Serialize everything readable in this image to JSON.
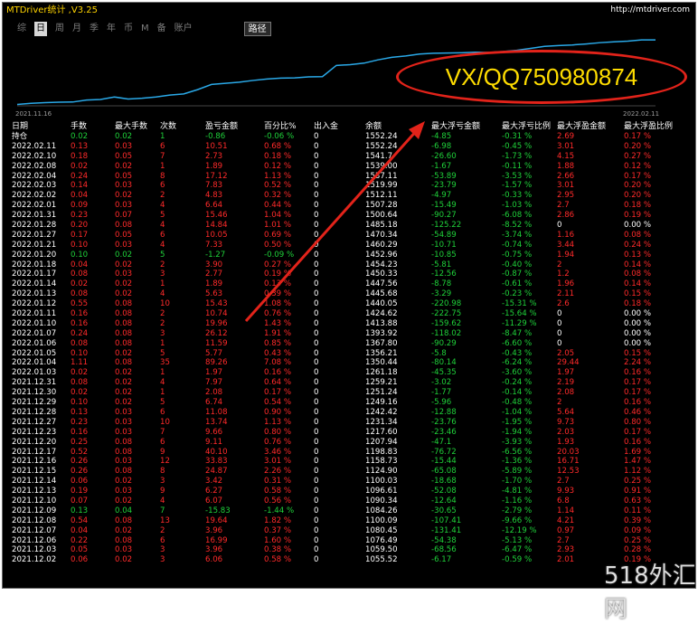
{
  "window": {
    "title": "MTDriver统计 ,V3.25",
    "url": "http://mtdriver.com"
  },
  "tabs": [
    {
      "label": "综",
      "active": false
    },
    {
      "label": "日",
      "active": true
    },
    {
      "label": "周",
      "active": false
    },
    {
      "label": "月",
      "active": false
    },
    {
      "label": "季",
      "active": false
    },
    {
      "label": "年",
      "active": false
    },
    {
      "label": "币",
      "active": false
    },
    {
      "label": "M",
      "active": false
    },
    {
      "label": "备",
      "active": false
    },
    {
      "label": "账户",
      "active": false
    }
  ],
  "path_button": "路径",
  "chart_data": {
    "type": "line",
    "x_start_label": "2021.11.16",
    "x_end_label": "2022.02.11",
    "y": [
      1041,
      1050,
      1055,
      1059,
      1060,
      1076,
      1080,
      1100,
      1084,
      1090,
      1100,
      1115,
      1124,
      1158,
      1199,
      1208,
      1217,
      1231,
      1242,
      1249,
      1251,
      1259,
      1261,
      1350,
      1356,
      1368,
      1394,
      1414,
      1425,
      1440,
      1446,
      1448,
      1450,
      1454,
      1453,
      1460,
      1470,
      1485,
      1501,
      1507,
      1512,
      1520,
      1530,
      1537,
      1542,
      1552,
      1552
    ],
    "ylim": [
      1030,
      1560
    ],
    "color": "#2aa9e8"
  },
  "watermark": "VX/QQ750980874",
  "brand": "518外汇网",
  "colors": {
    "red": "#ff2a2a",
    "green": "#1fd13a",
    "line": "#2aa9e8",
    "title": "#ffd400"
  },
  "table": {
    "headers": [
      "日期",
      "手数",
      "最大手数",
      "次数",
      "盈亏金额",
      "百分比%",
      "出入金",
      "余额",
      "最大浮亏金额",
      "最大浮亏比例",
      "最大浮盈金额",
      "最大浮盈比例"
    ],
    "rows": [
      [
        "持仓",
        "0.02",
        "0.02",
        "1",
        "-0.86",
        "-0.06 %",
        "0",
        "1552.24",
        "-4.85",
        "-0.31 %",
        "2.69",
        "0.17 %"
      ],
      [
        "2022.02.11",
        "0.13",
        "0.03",
        "6",
        "10.51",
        "0.68 %",
        "0",
        "1552.24",
        "-6.98",
        "-0.45 %",
        "3.01",
        "0.20 %"
      ],
      [
        "2022.02.10",
        "0.18",
        "0.05",
        "7",
        "2.73",
        "0.18 %",
        "0",
        "1541.7",
        "-26.60",
        "-1.73 %",
        "4.15",
        "0.27 %"
      ],
      [
        "2022.02.08",
        "0.02",
        "0.02",
        "1",
        "1.89",
        "0.12 %",
        "0",
        "1539.00",
        "-1.67",
        "-0.11 %",
        "1.88",
        "0.12 %"
      ],
      [
        "2022.02.04",
        "0.24",
        "0.05",
        "8",
        "17.12",
        "1.13 %",
        "0",
        "1537.11",
        "-53.89",
        "-3.53 %",
        "2.66",
        "0.17 %"
      ],
      [
        "2022.02.03",
        "0.14",
        "0.03",
        "6",
        "7.83",
        "0.52 %",
        "0",
        "1519.99",
        "-23.79",
        "-1.57 %",
        "3.01",
        "0.20 %"
      ],
      [
        "2022.02.02",
        "0.04",
        "0.02",
        "2",
        "4.83",
        "0.32 %",
        "0",
        "1512.11",
        "-4.97",
        "-0.33 %",
        "2.95",
        "0.20 %"
      ],
      [
        "2022.02.01",
        "0.09",
        "0.03",
        "4",
        "6.64",
        "0.44 %",
        "0",
        "1507.28",
        "-15.49",
        "-1.03 %",
        "2.7",
        "0.18 %"
      ],
      [
        "2022.01.31",
        "0.23",
        "0.07",
        "5",
        "15.46",
        "1.04 %",
        "0",
        "1500.64",
        "-90.27",
        "-6.08 %",
        "2.86",
        "0.19 %"
      ],
      [
        "2022.01.28",
        "0.20",
        "0.08",
        "4",
        "14.84",
        "1.01 %",
        "0",
        "1485.18",
        "-125.22",
        "-8.52 %",
        "0",
        "0.00 %"
      ],
      [
        "2022.01.27",
        "0.17",
        "0.05",
        "6",
        "10.05",
        "0.69 %",
        "0",
        "1470.34",
        "-54.89",
        "-3.74 %",
        "1.16",
        "0.08 %"
      ],
      [
        "2022.01.21",
        "0.10",
        "0.03",
        "4",
        "7.33",
        "0.50 %",
        "0",
        "1460.29",
        "-10.71",
        "-0.74 %",
        "3.44",
        "0.24 %"
      ],
      [
        "2022.01.20",
        "0.10",
        "0.02",
        "5",
        "-1.27",
        "-0.09 %",
        "0",
        "1452.96",
        "-10.85",
        "-0.75 %",
        "1.94",
        "0.13 %"
      ],
      [
        "2022.01.18",
        "0.04",
        "0.02",
        "2",
        "3.90",
        "0.27 %",
        "0",
        "1454.23",
        "-5.81",
        "-0.40 %",
        "2",
        "0.14 %"
      ],
      [
        "2022.01.17",
        "0.08",
        "0.03",
        "3",
        "2.77",
        "0.19 %",
        "0",
        "1450.33",
        "-12.56",
        "-0.87 %",
        "1.2",
        "0.08 %"
      ],
      [
        "2022.01.14",
        "0.02",
        "0.02",
        "1",
        "1.89",
        "0.13 %",
        "0",
        "1447.56",
        "-8.78",
        "-0.61 %",
        "1.96",
        "0.14 %"
      ],
      [
        "2022.01.13",
        "0.08",
        "0.02",
        "4",
        "5.63",
        "0.39 %",
        "0",
        "1445.68",
        "-3.29",
        "-0.23 %",
        "2.11",
        "0.15 %"
      ],
      [
        "2022.01.12",
        "0.55",
        "0.08",
        "10",
        "15.43",
        "1.08 %",
        "0",
        "1440.05",
        "-220.98",
        "-15.31 %",
        "2.6",
        "0.18 %"
      ],
      [
        "2022.01.11",
        "0.16",
        "0.08",
        "2",
        "10.74",
        "0.76 %",
        "0",
        "1424.62",
        "-222.75",
        "-15.64 %",
        "0",
        "0.00 %"
      ],
      [
        "2022.01.10",
        "0.16",
        "0.08",
        "2",
        "19.96",
        "1.43 %",
        "0",
        "1413.88",
        "-159.62",
        "-11.29 %",
        "0",
        "0.00 %"
      ],
      [
        "2022.01.07",
        "0.24",
        "0.08",
        "3",
        "26.12",
        "1.91 %",
        "0",
        "1393.92",
        "-118.02",
        "-8.47 %",
        "0",
        "0.00 %"
      ],
      [
        "2022.01.06",
        "0.08",
        "0.08",
        "1",
        "11.59",
        "0.85 %",
        "0",
        "1367.80",
        "-90.29",
        "-6.60 %",
        "0",
        "0.00 %"
      ],
      [
        "2022.01.05",
        "0.10",
        "0.02",
        "5",
        "5.77",
        "0.43 %",
        "0",
        "1356.21",
        "-5.8",
        "-0.43 %",
        "2.05",
        "0.15 %"
      ],
      [
        "2022.01.04",
        "1.11",
        "0.08",
        "35",
        "89.26",
        "7.08 %",
        "0",
        "1350.44",
        "-80.14",
        "-6.24 %",
        "29.44",
        "2.24 %"
      ],
      [
        "2022.01.03",
        "0.02",
        "0.02",
        "1",
        "1.97",
        "0.16 %",
        "0",
        "1261.18",
        "-45.35",
        "-3.60 %",
        "1.97",
        "0.16 %"
      ],
      [
        "2021.12.31",
        "0.08",
        "0.02",
        "4",
        "7.97",
        "0.64 %",
        "0",
        "1259.21",
        "-3.02",
        "-0.24 %",
        "2.19",
        "0.17 %"
      ],
      [
        "2021.12.30",
        "0.02",
        "0.02",
        "1",
        "2.08",
        "0.17 %",
        "0",
        "1251.24",
        "-1.77",
        "-0.14 %",
        "2.08",
        "0.17 %"
      ],
      [
        "2021.12.29",
        "0.10",
        "0.02",
        "5",
        "6.74",
        "0.54 %",
        "0",
        "1249.16",
        "-5.96",
        "-0.48 %",
        "2",
        "0.16 %"
      ],
      [
        "2021.12.28",
        "0.13",
        "0.03",
        "6",
        "11.08",
        "0.90 %",
        "0",
        "1242.42",
        "-12.88",
        "-1.04 %",
        "5.64",
        "0.46 %"
      ],
      [
        "2021.12.27",
        "0.23",
        "0.03",
        "10",
        "13.74",
        "1.13 %",
        "0",
        "1231.34",
        "-23.76",
        "-1.95 %",
        "9.73",
        "0.80 %"
      ],
      [
        "2021.12.23",
        "0.16",
        "0.03",
        "7",
        "9.66",
        "0.80 %",
        "0",
        "1217.60",
        "-23.46",
        "-1.94 %",
        "2.03",
        "0.17 %"
      ],
      [
        "2021.12.20",
        "0.25",
        "0.08",
        "6",
        "9.11",
        "0.76 %",
        "0",
        "1207.94",
        "-47.1",
        "-3.93 %",
        "1.93",
        "0.16 %"
      ],
      [
        "2021.12.17",
        "0.52",
        "0.08",
        "9",
        "40.10",
        "3.46 %",
        "0",
        "1198.83",
        "-76.72",
        "-6.56 %",
        "20.03",
        "1.69 %"
      ],
      [
        "2021.12.16",
        "0.26",
        "0.03",
        "12",
        "33.83",
        "3.01 %",
        "0",
        "1158.73",
        "-15.44",
        "-1.36 %",
        "16.71",
        "1.47 %"
      ],
      [
        "2021.12.15",
        "0.26",
        "0.08",
        "8",
        "24.87",
        "2.26 %",
        "0",
        "1124.90",
        "-65.08",
        "-5.89 %",
        "12.53",
        "1.12 %"
      ],
      [
        "2021.12.14",
        "0.06",
        "0.02",
        "3",
        "3.42",
        "0.31 %",
        "0",
        "1100.03",
        "-18.68",
        "-1.70 %",
        "2.7",
        "0.25 %"
      ],
      [
        "2021.12.13",
        "0.19",
        "0.03",
        "9",
        "6.27",
        "0.58 %",
        "0",
        "1096.61",
        "-52.08",
        "-4.81 %",
        "9.93",
        "0.91 %"
      ],
      [
        "2021.12.10",
        "0.07",
        "0.02",
        "4",
        "6.07",
        "0.56 %",
        "0",
        "1090.34",
        "-12.64",
        "-1.16 %",
        "6.8",
        "0.63 %"
      ],
      [
        "2021.12.09",
        "0.13",
        "0.04",
        "7",
        "-15.83",
        "-1.44 %",
        "0",
        "1084.26",
        "-30.65",
        "-2.79 %",
        "1.14",
        "0.11 %"
      ],
      [
        "2021.12.08",
        "0.54",
        "0.08",
        "13",
        "19.64",
        "1.82 %",
        "0",
        "1100.09",
        "-107.41",
        "-9.66 %",
        "4.21",
        "0.39 %"
      ],
      [
        "2021.12.07",
        "0.04",
        "0.02",
        "2",
        "3.96",
        "0.37 %",
        "0",
        "1080.45",
        "-131.41",
        "-12.19 %",
        "0.97",
        "0.09 %"
      ],
      [
        "2021.12.06",
        "0.22",
        "0.08",
        "6",
        "16.99",
        "1.60 %",
        "0",
        "1076.49",
        "-54.38",
        "-5.13 %",
        "2.7",
        "0.25 %"
      ],
      [
        "2021.12.03",
        "0.05",
        "0.03",
        "3",
        "3.96",
        "0.38 %",
        "0",
        "1059.50",
        "-68.56",
        "-6.47 %",
        "2.93",
        "0.28 %"
      ],
      [
        "2021.12.02",
        "0.06",
        "0.02",
        "3",
        "6.06",
        "0.58 %",
        "0",
        "1055.52",
        "-6.17",
        "-0.59 %",
        "2.01",
        "0.19 %"
      ]
    ]
  }
}
